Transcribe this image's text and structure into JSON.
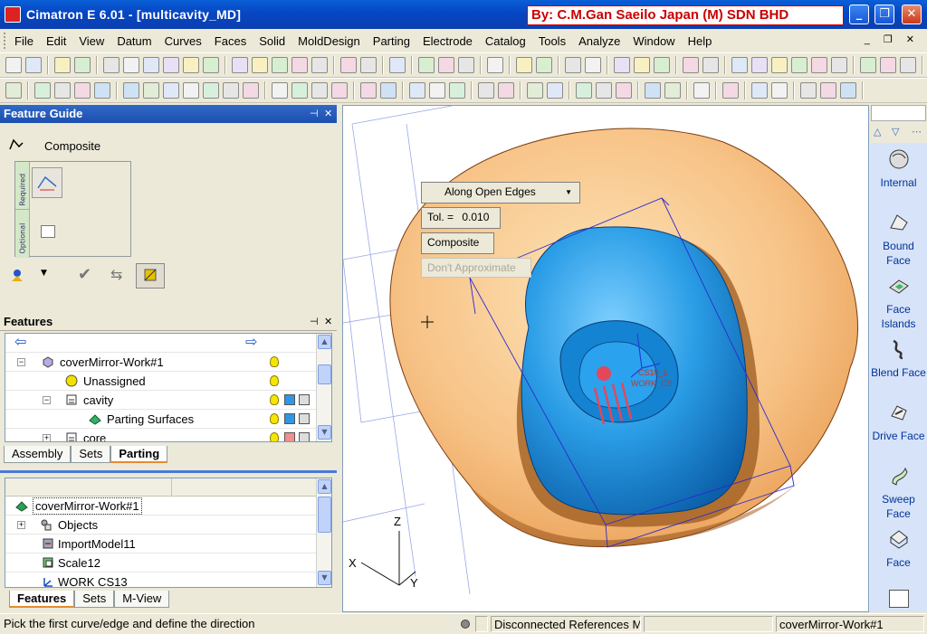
{
  "window": {
    "title": "Cimatron E 6.01 - [multicavity_MD]",
    "watermark": "By: C.M.Gan Saeilo Japan (M) SDN BHD"
  },
  "menu": [
    "File",
    "Edit",
    "View",
    "Datum",
    "Curves",
    "Faces",
    "Solid",
    "MoldDesign",
    "Parting",
    "Electrode",
    "Catalog",
    "Tools",
    "Analyze",
    "Window",
    "Help"
  ],
  "feature_guide": {
    "title": "Feature Guide",
    "mode_label": "Composite",
    "required_label": "Required",
    "optional_label": "Optional"
  },
  "features_panel": {
    "title": "Features",
    "rows": [
      "coverMirror-Work#1",
      "Unassigned",
      "cavity",
      "Parting Surfaces",
      "core"
    ],
    "tabs": [
      "Assembly",
      "Sets",
      "Parting"
    ],
    "active_tab": "Parting",
    "colors": {
      "cavity": "#2f97e6",
      "parting": "#2f97e6",
      "core": "#ef8f8f"
    }
  },
  "tree_panel": {
    "rows": [
      "coverMirror-Work#1",
      "Objects",
      "ImportModel11",
      "Scale12",
      "WORK CS13"
    ],
    "tabs": [
      "Features",
      "Sets",
      "M-View"
    ],
    "active_tab": "Features"
  },
  "viewport": {
    "mode_dropdown": "Along Open Edges",
    "tol_label": "Tol. =",
    "tol_value": "0.010",
    "composite_button": "Composite",
    "dont_approximate_button": "Don't Approximate",
    "axis_labels": {
      "z": "Z",
      "x": "X",
      "y": "Y"
    },
    "cs_labels": [
      "CS10_1",
      "WORK_CS"
    ]
  },
  "right_toolbar": {
    "items": [
      "Internal",
      "Bound Face",
      "Face Islands",
      "Blend Face",
      "Drive Face",
      "Sweep Face",
      "Face"
    ]
  },
  "status": {
    "prompt": "Pick the first curve/edge and define the direction",
    "disconnected": "Disconnected References M",
    "active_part": "coverMirror-Work#1"
  }
}
